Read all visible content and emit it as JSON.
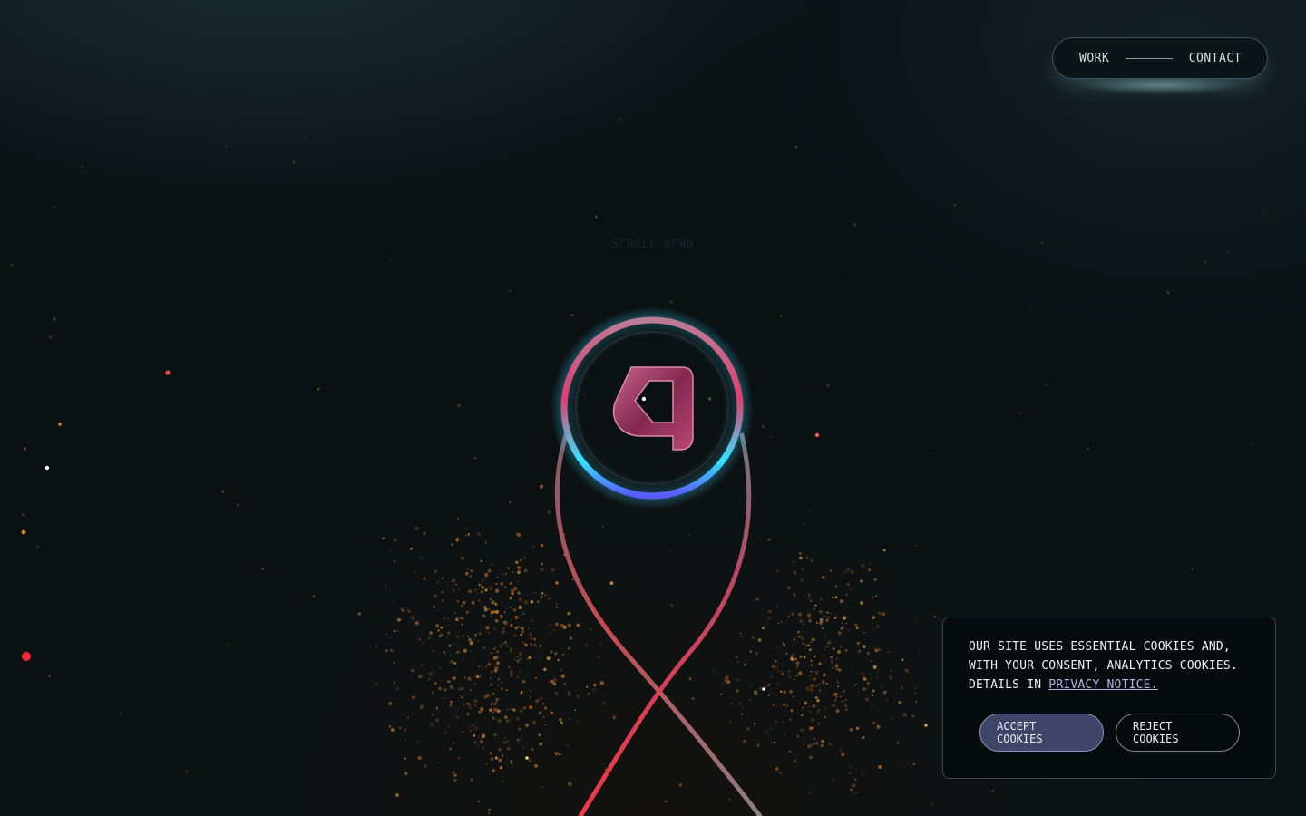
{
  "nav": {
    "work_label": "WORK",
    "contact_label": "CONTACT"
  },
  "hero": {
    "scroll_hint": "SCROLL DOWN",
    "logo_letter": "a"
  },
  "cookie_banner": {
    "text_before_link": "OUR SITE USES ESSENTIAL COOKIES AND, WITH YOUR CONSENT, ANALYTICS COOKIES. DETAILS IN ",
    "link_text": "PRIVACY NOTICE.",
    "accept_label": "ACCEPT COOKIES",
    "reject_label": "REJECT COOKIES"
  },
  "colors": {
    "background": "#0a1113",
    "accent": "#3f4568",
    "ring_cyan": "#34e4ff",
    "ring_magenta": "#e0457a",
    "particle_orange": "#c8742c"
  },
  "icons": {
    "logo": "a-ring-logo",
    "ribbon": "ribbon-loop"
  }
}
